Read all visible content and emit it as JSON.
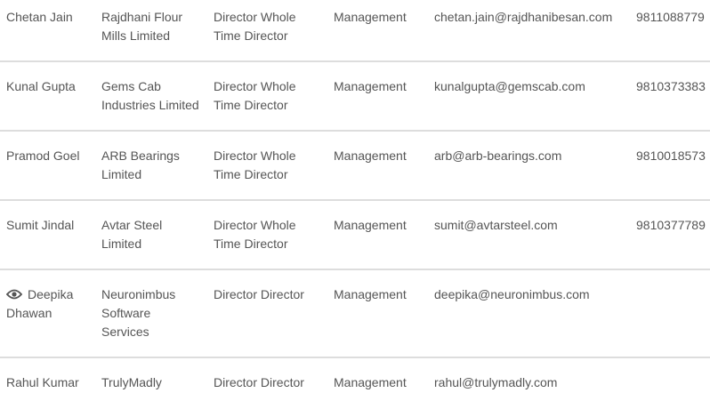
{
  "rows": [
    {
      "name": "Chetan Jain",
      "company": "Rajdhani Flour Mills Limited",
      "designation": "Director Whole Time Director",
      "department": "Management",
      "email": "chetan.jain@rajdhanibesan.com",
      "phone": "9811088779"
    },
    {
      "name": "Kunal Gupta",
      "company": "Gems Cab Industries Limited",
      "designation": "Director Whole Time Director",
      "department": "Management",
      "email": "kunalgupta@gemscab.com",
      "phone": "9810373383"
    },
    {
      "name": "Pramod Goel",
      "company": "ARB Bearings Limited",
      "designation": "Director Whole Time Director",
      "department": "Management",
      "email": "arb@arb-bearings.com",
      "phone": "9810018573"
    },
    {
      "name": "Sumit Jindal",
      "company": "Avtar Steel Limited",
      "designation": "Director Whole Time Director",
      "department": "Management",
      "email": "sumit@avtarsteel.com",
      "phone": "9810377789"
    },
    {
      "name": "Deepika Dhawan",
      "icon": "eye-icon",
      "company": "Neuronimbus Software Services",
      "designation": "Director Director",
      "department": "Management",
      "email": "deepika@neuronimbus.com",
      "phone": ""
    },
    {
      "name": "Rahul Kumar",
      "company": "TrulyMadly",
      "designation": "Director Director",
      "department": "Management",
      "email": "rahul@trulymadly.com",
      "phone": ""
    }
  ]
}
